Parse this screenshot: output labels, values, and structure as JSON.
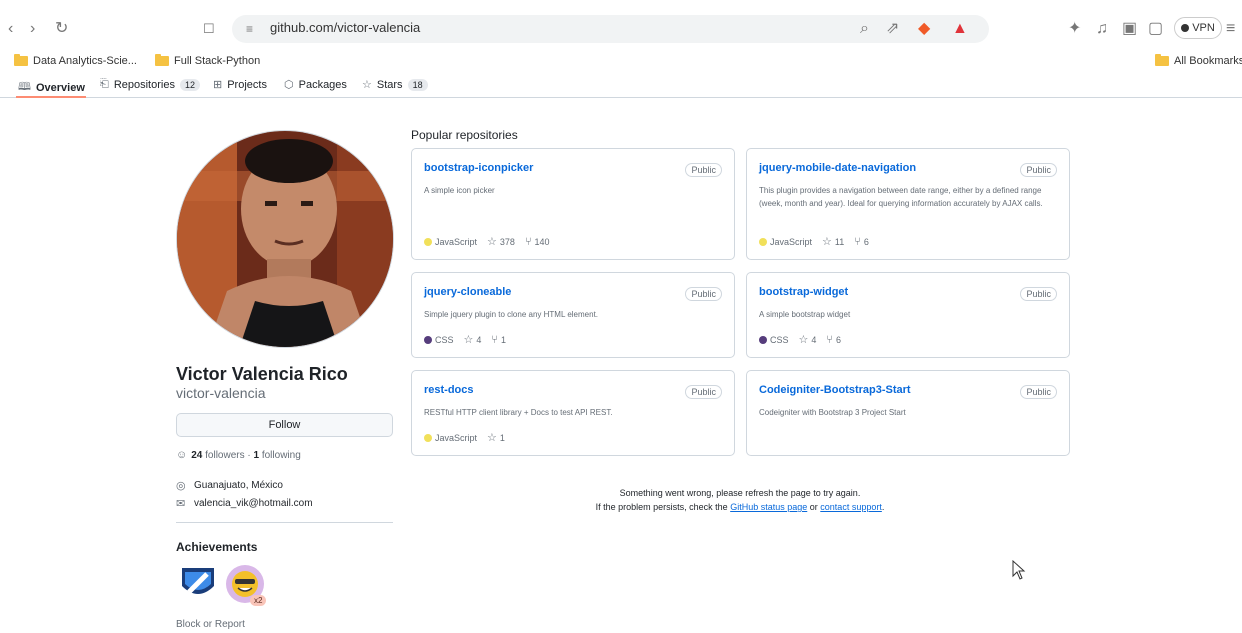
{
  "browser": {
    "url": "github.com/victor-valencia",
    "vpn_label": "VPN",
    "bookmarks": [
      "Data Analytics-Scie...",
      "Full Stack-Python"
    ],
    "all_bookmarks": "All Bookmarks"
  },
  "tabs": [
    {
      "label": "Overview",
      "count": "",
      "icon": "book-icon"
    },
    {
      "label": "Repositories",
      "count": "12",
      "icon": "repo-icon"
    },
    {
      "label": "Projects",
      "count": "",
      "icon": "table-icon"
    },
    {
      "label": "Packages",
      "count": "",
      "icon": "package-icon"
    },
    {
      "label": "Stars",
      "count": "18",
      "icon": "star-icon"
    }
  ],
  "profile": {
    "name": "Victor Valencia Rico",
    "login": "victor-valencia",
    "follow_label": "Follow",
    "followers_count": "24",
    "followers_label": "followers",
    "following_count": "1",
    "following_label": "following",
    "location": "Guanajuato, México",
    "email": "valencia_vik@hotmail.com",
    "achievements_title": "Achievements",
    "achievement_multiplier": "x2",
    "block_label": "Block or Report"
  },
  "popular": {
    "title": "Popular repositories",
    "repos": [
      {
        "name": "bootstrap-iconpicker",
        "visibility": "Public",
        "description": "A simple icon picker",
        "language": "JavaScript",
        "lang_color": "#f1e05a",
        "stars": "378",
        "forks": "140"
      },
      {
        "name": "jquery-mobile-date-navigation",
        "visibility": "Public",
        "description": "This plugin provides a navigation between date range, either by a defined range (week, month and year). Ideal for querying information accurately by AJAX calls.",
        "language": "JavaScript",
        "lang_color": "#f1e05a",
        "stars": "11",
        "forks": "6"
      },
      {
        "name": "jquery-cloneable",
        "visibility": "Public",
        "description": "Simple jquery plugin to clone any HTML element.",
        "language": "CSS",
        "lang_color": "#563d7c",
        "stars": "4",
        "forks": "1"
      },
      {
        "name": "bootstrap-widget",
        "visibility": "Public",
        "description": "A simple bootstrap widget",
        "language": "CSS",
        "lang_color": "#563d7c",
        "stars": "4",
        "forks": "6"
      },
      {
        "name": "rest-docs",
        "visibility": "Public",
        "description": "RESTful HTTP client library + Docs to test API REST.",
        "language": "JavaScript",
        "lang_color": "#f1e05a",
        "stars": "1",
        "forks": ""
      },
      {
        "name": "Codeigniter-Bootstrap3-Start",
        "visibility": "Public",
        "description": "Codeigniter with Bootstrap 3 Project Start",
        "language": "",
        "lang_color": "",
        "stars": "",
        "forks": ""
      }
    ]
  },
  "error": {
    "line1": "Something went wrong, please refresh the page to try again.",
    "line2_prefix": "If the problem persists, check the",
    "status_link": "GitHub status page",
    "or": "or",
    "support_link": "contact support",
    "period": "."
  }
}
